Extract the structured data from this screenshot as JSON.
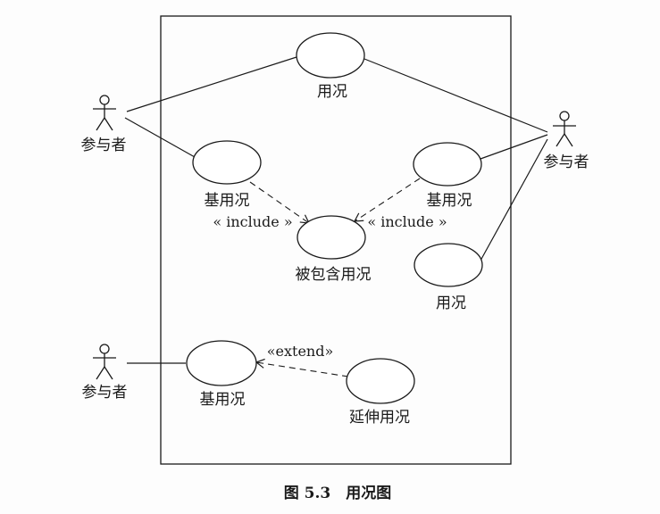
{
  "diagram": {
    "caption": "图 5.3　用况图",
    "actors": [
      {
        "label": "参与者"
      },
      {
        "label": "参与者"
      },
      {
        "label": "参与者"
      }
    ],
    "use_cases": [
      {
        "label": "用况"
      },
      {
        "label": "基用况"
      },
      {
        "label": "被包含用况"
      },
      {
        "label": "基用况"
      },
      {
        "label": "用况"
      },
      {
        "label": "基用况"
      },
      {
        "label": "延伸用况"
      }
    ],
    "stereotypes": {
      "include_left": "« include »",
      "include_right": "« include »",
      "extend": "«extend»"
    }
  }
}
